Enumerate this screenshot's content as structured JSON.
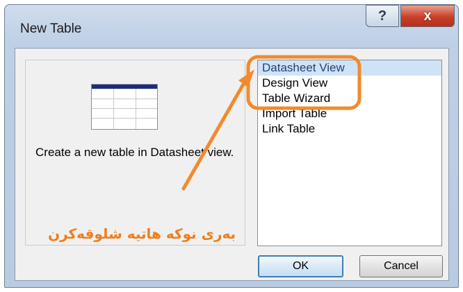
{
  "window": {
    "title": "New Table",
    "help_glyph": "?",
    "close_glyph": "x"
  },
  "preview": {
    "icon": "table-icon",
    "description": "Create a new table in Datasheet view."
  },
  "list": {
    "items": [
      {
        "label": "Datasheet View",
        "selected": true
      },
      {
        "label": "Design View",
        "selected": false
      },
      {
        "label": "Table Wizard",
        "selected": false
      },
      {
        "label": "Import Table",
        "selected": false
      },
      {
        "label": "Link Table",
        "selected": false
      }
    ]
  },
  "buttons": {
    "ok": "OK",
    "cancel": "Cancel"
  },
  "annotation": {
    "text": "بەری نوکە هاتیە شلوقەکرن",
    "color": "#f07d1a"
  }
}
